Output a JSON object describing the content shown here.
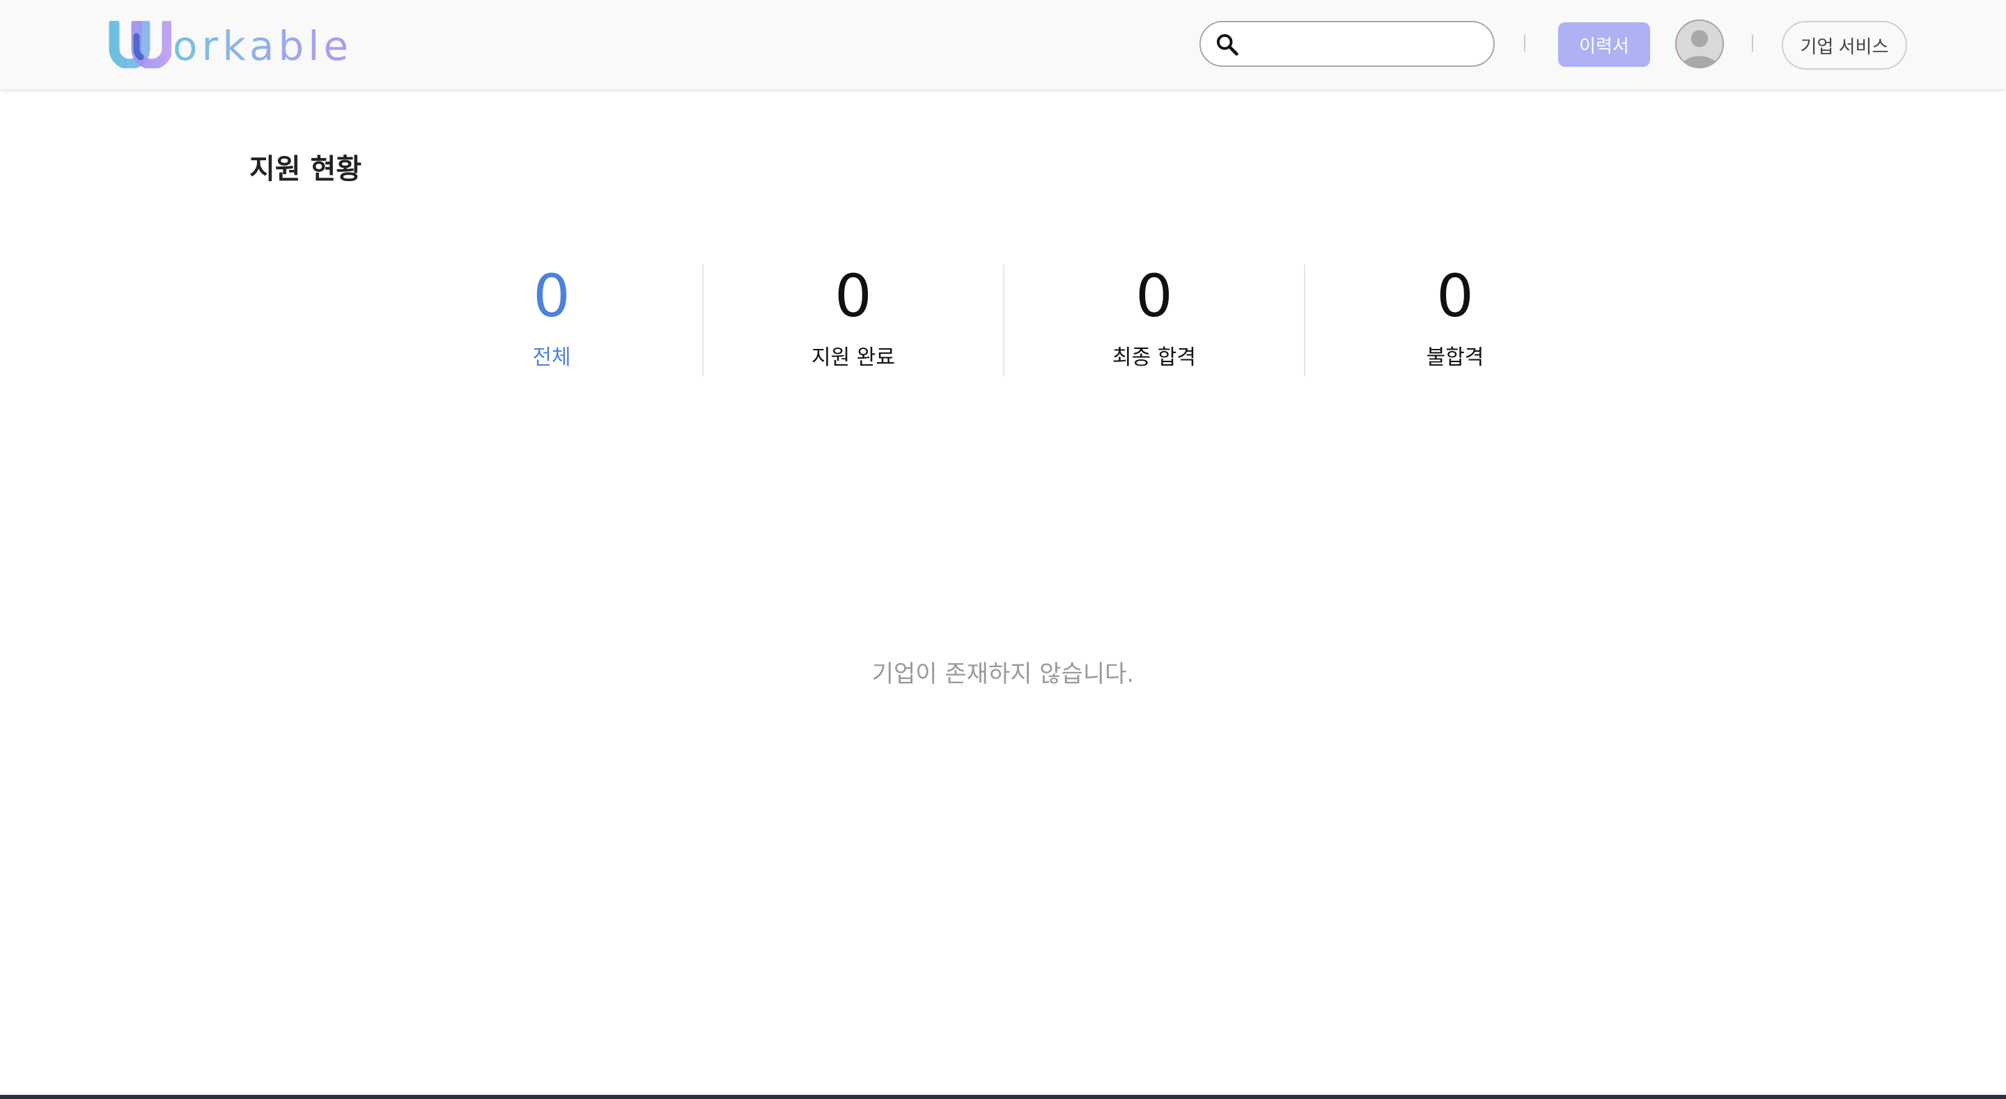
{
  "header": {
    "logo_text": "orkable",
    "logo_alt": "Workable",
    "search_placeholder": "",
    "resume_button": "이력서",
    "corporate_button": "기업 서비스"
  },
  "page": {
    "title": "지원 현황"
  },
  "stats": [
    {
      "count": "0",
      "label": "전체",
      "active": true
    },
    {
      "count": "0",
      "label": "지원 완료",
      "active": false
    },
    {
      "count": "0",
      "label": "최종 합격",
      "active": false
    },
    {
      "count": "0",
      "label": "불합격",
      "active": false
    }
  ],
  "empty_message": "기업이 존재하지 않습니다.",
  "colors": {
    "accent": "#4d81e0",
    "resume_button_bg": "#aeb1f4",
    "logo_gradient_start": "#74c3e0",
    "logo_gradient_end": "#b396f0"
  },
  "icons": {
    "search": "search-icon",
    "avatar": "user-avatar-icon"
  }
}
